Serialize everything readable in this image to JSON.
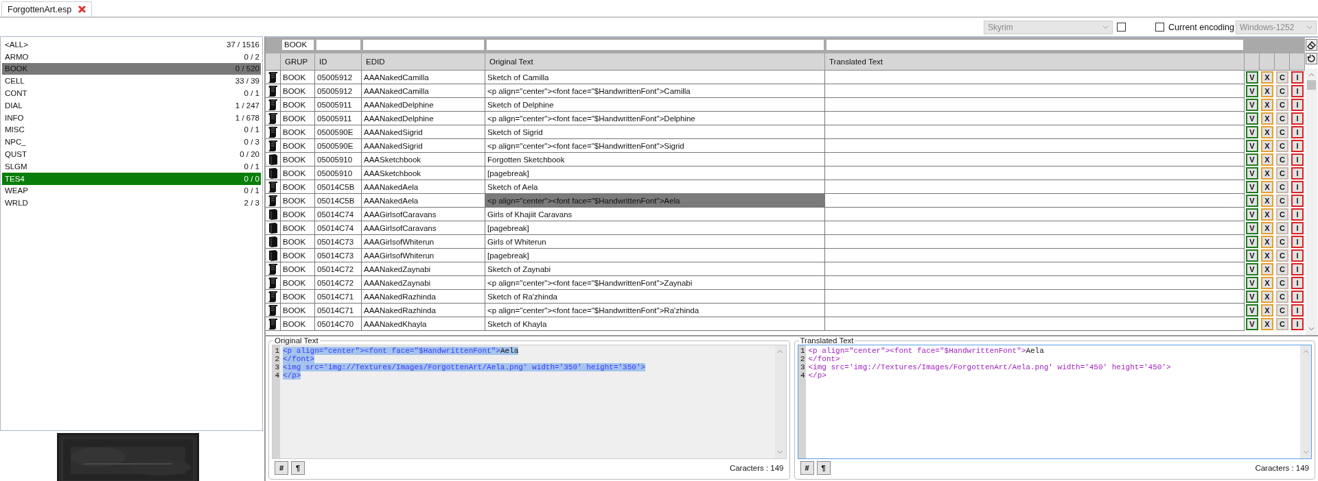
{
  "tabs": [
    {
      "label": "ForgottenArt.esp"
    }
  ],
  "toolbar": {
    "game_select": {
      "value": "Skyrim",
      "disabled": true
    },
    "game_checkbox": {
      "checked": false
    },
    "encoding_checkbox": {
      "label": "Current encoding",
      "checked": false
    },
    "encoding_select": {
      "value": "Windows-1252",
      "disabled": true
    }
  },
  "record_types": [
    {
      "label": "<ALL>",
      "count": "37 / 1516",
      "selected": false,
      "complete": false
    },
    {
      "label": "ARMO",
      "count": "0 / 2",
      "selected": false,
      "complete": false
    },
    {
      "label": "BOOK",
      "count": "0 / 520",
      "selected": true,
      "complete": false
    },
    {
      "label": "CELL",
      "count": "33 / 39",
      "selected": false,
      "complete": false
    },
    {
      "label": "CONT",
      "count": "0 / 1",
      "selected": false,
      "complete": false
    },
    {
      "label": "DIAL",
      "count": "1 / 247",
      "selected": false,
      "complete": false
    },
    {
      "label": "INFO",
      "count": "1 / 678",
      "selected": false,
      "complete": false
    },
    {
      "label": "MISC",
      "count": "0 / 1",
      "selected": false,
      "complete": false
    },
    {
      "label": "NPC_",
      "count": "0 / 3",
      "selected": false,
      "complete": false
    },
    {
      "label": "QUST",
      "count": "0 / 20",
      "selected": false,
      "complete": false
    },
    {
      "label": "SLGM",
      "count": "0 / 1",
      "selected": false,
      "complete": false
    },
    {
      "label": "TES4",
      "count": "0 / 0",
      "selected": false,
      "complete": true
    },
    {
      "label": "WEAP",
      "count": "0 / 1",
      "selected": false,
      "complete": false
    },
    {
      "label": "WRLD",
      "count": "2 / 3",
      "selected": false,
      "complete": false
    }
  ],
  "table": {
    "columns": [
      {
        "label": "GRUP",
        "filter": "BOOK"
      },
      {
        "label": "ID"
      },
      {
        "label": "EDID"
      },
      {
        "label": "Original Text"
      },
      {
        "label": "Translated Text"
      }
    ],
    "rows": [
      {
        "kind": "scroll",
        "grup": "BOOK",
        "id": "05005912",
        "edid": "AAANakedCamilla",
        "original": "Sketch of Camilla",
        "selected": false,
        "actions": [
          {
            "label": "V",
            "color": "#1f7a1f"
          },
          {
            "label": "X",
            "color": "#e8a030"
          },
          {
            "label": "C",
            "color": "#c9b9a6"
          },
          {
            "label": "I",
            "color": "#e02020"
          }
        ]
      },
      {
        "kind": "scroll",
        "grup": "BOOK",
        "id": "05005912",
        "edid": "AAANakedCamilla",
        "original": "<p align=\"center\"><font face=\"$HandwrittenFont\">Camilla",
        "selected": false,
        "actions": [
          {
            "label": "V",
            "color": "#1f7a1f"
          },
          {
            "label": "X",
            "color": "#e8a030"
          },
          {
            "label": "C",
            "color": "#c9b9a6"
          },
          {
            "label": "I",
            "color": "#e02020"
          }
        ]
      },
      {
        "kind": "scroll",
        "grup": "BOOK",
        "id": "05005911",
        "edid": "AAANakedDelphine",
        "original": "Sketch of Delphine",
        "selected": false,
        "actions": [
          {
            "label": "V",
            "color": "#1f7a1f"
          },
          {
            "label": "X",
            "color": "#e8a030"
          },
          {
            "label": "C",
            "color": "#c9b9a6"
          },
          {
            "label": "I",
            "color": "#e02020"
          }
        ]
      },
      {
        "kind": "scroll",
        "grup": "BOOK",
        "id": "05005911",
        "edid": "AAANakedDelphine",
        "original": "<p align=\"center\"><font face=\"$HandwrittenFont\">Delphine",
        "selected": false,
        "actions": [
          {
            "label": "V",
            "color": "#1f7a1f"
          },
          {
            "label": "X",
            "color": "#e8a030"
          },
          {
            "label": "C",
            "color": "#c9b9a6"
          },
          {
            "label": "I",
            "color": "#e02020"
          }
        ]
      },
      {
        "kind": "scroll",
        "grup": "BOOK",
        "id": "0500590E",
        "edid": "AAANakedSigrid",
        "original": "Sketch of Sigrid",
        "selected": false,
        "actions": [
          {
            "label": "V",
            "color": "#1f7a1f"
          },
          {
            "label": "X",
            "color": "#e8a030"
          },
          {
            "label": "C",
            "color": "#c9b9a6"
          },
          {
            "label": "I",
            "color": "#e02020"
          }
        ]
      },
      {
        "kind": "scroll",
        "grup": "BOOK",
        "id": "0500590E",
        "edid": "AAANakedSigrid",
        "original": "<p align=\"center\"><font face=\"$HandwrittenFont\">Sigrid",
        "selected": false,
        "actions": [
          {
            "label": "V",
            "color": "#1f7a1f"
          },
          {
            "label": "X",
            "color": "#e8a030"
          },
          {
            "label": "C",
            "color": "#c9b9a6"
          },
          {
            "label": "I",
            "color": "#e02020"
          }
        ]
      },
      {
        "kind": "book",
        "grup": "BOOK",
        "id": "05005910",
        "edid": "AAASketchbook",
        "original": "Forgotten Sketchbook",
        "selected": false,
        "actions": [
          {
            "label": "V",
            "color": "#1f7a1f"
          },
          {
            "label": "X",
            "color": "#e8a030"
          },
          {
            "label": "C",
            "color": "#c9b9a6"
          },
          {
            "label": "I",
            "color": "#e02020"
          }
        ]
      },
      {
        "kind": "book",
        "grup": "BOOK",
        "id": "05005910",
        "edid": "AAASketchbook",
        "original": "[pagebreak]",
        "selected": false,
        "actions": [
          {
            "label": "V",
            "color": "#1f7a1f"
          },
          {
            "label": "X",
            "color": "#e8a030"
          },
          {
            "label": "C",
            "color": "#c9b9a6"
          },
          {
            "label": "I",
            "color": "#e02020"
          }
        ]
      },
      {
        "kind": "scroll",
        "grup": "BOOK",
        "id": "05014C5B",
        "edid": "AAANakedAela",
        "original": "Sketch of Aela",
        "selected": false,
        "actions": [
          {
            "label": "V",
            "color": "#1f7a1f"
          },
          {
            "label": "X",
            "color": "#e8a030"
          },
          {
            "label": "C",
            "color": "#c9b9a6"
          },
          {
            "label": "I",
            "color": "#e02020"
          }
        ]
      },
      {
        "kind": "scroll",
        "grup": "BOOK",
        "id": "05014C5B",
        "edid": "AAANakedAela",
        "original": "<p align=\"center\"><font face=\"$HandwrittenFont\">Aela",
        "selected": true,
        "actions": [
          {
            "label": "V",
            "color": "#1f7a1f"
          },
          {
            "label": "X",
            "color": "#e8a030"
          },
          {
            "label": "C",
            "color": "#c9b9a6"
          },
          {
            "label": "I",
            "color": "#e02020"
          }
        ]
      },
      {
        "kind": "book",
        "grup": "BOOK",
        "id": "05014C74",
        "edid": "AAAGirlsofCaravans",
        "original": "Girls of Khajiit Caravans",
        "selected": false,
        "actions": [
          {
            "label": "V",
            "color": "#1f7a1f"
          },
          {
            "label": "X",
            "color": "#e8a030"
          },
          {
            "label": "C",
            "color": "#c9b9a6"
          },
          {
            "label": "I",
            "color": "#e02020"
          }
        ]
      },
      {
        "kind": "book",
        "grup": "BOOK",
        "id": "05014C74",
        "edid": "AAAGirlsofCaravans",
        "original": "[pagebreak]",
        "selected": false,
        "actions": [
          {
            "label": "V",
            "color": "#1f7a1f"
          },
          {
            "label": "X",
            "color": "#e8a030"
          },
          {
            "label": "C",
            "color": "#c9b9a6"
          },
          {
            "label": "I",
            "color": "#e02020"
          }
        ]
      },
      {
        "kind": "book",
        "grup": "BOOK",
        "id": "05014C73",
        "edid": "AAAGirlsofWhiterun",
        "original": "Girls of Whiterun",
        "selected": false,
        "actions": [
          {
            "label": "V",
            "color": "#1f7a1f"
          },
          {
            "label": "X",
            "color": "#e8a030"
          },
          {
            "label": "C",
            "color": "#c9b9a6"
          },
          {
            "label": "I",
            "color": "#e02020"
          }
        ]
      },
      {
        "kind": "book",
        "grup": "BOOK",
        "id": "05014C73",
        "edid": "AAAGirlsofWhiterun",
        "original": "[pagebreak]",
        "selected": false,
        "actions": [
          {
            "label": "V",
            "color": "#1f7a1f"
          },
          {
            "label": "X",
            "color": "#e8a030"
          },
          {
            "label": "C",
            "color": "#c9b9a6"
          },
          {
            "label": "I",
            "color": "#e02020"
          }
        ]
      },
      {
        "kind": "scroll",
        "grup": "BOOK",
        "id": "05014C72",
        "edid": "AAANakedZaynabi",
        "original": "Sketch of Zaynabi",
        "selected": false,
        "actions": [
          {
            "label": "V",
            "color": "#1f7a1f"
          },
          {
            "label": "X",
            "color": "#e8a030"
          },
          {
            "label": "C",
            "color": "#c9b9a6"
          },
          {
            "label": "I",
            "color": "#e02020"
          }
        ]
      },
      {
        "kind": "scroll",
        "grup": "BOOK",
        "id": "05014C72",
        "edid": "AAANakedZaynabi",
        "original": "<p align=\"center\"><font face=\"$HandwrittenFont\">Zaynabi",
        "selected": false,
        "actions": [
          {
            "label": "V",
            "color": "#1f7a1f"
          },
          {
            "label": "X",
            "color": "#e8a030"
          },
          {
            "label": "C",
            "color": "#c9b9a6"
          },
          {
            "label": "I",
            "color": "#e02020"
          }
        ]
      },
      {
        "kind": "scroll",
        "grup": "BOOK",
        "id": "05014C71",
        "edid": "AAANakedRazhinda",
        "original": "Sketch of Ra'zhinda",
        "selected": false,
        "actions": [
          {
            "label": "V",
            "color": "#1f7a1f"
          },
          {
            "label": "X",
            "color": "#e8a030"
          },
          {
            "label": "C",
            "color": "#c9b9a6"
          },
          {
            "label": "I",
            "color": "#e02020"
          }
        ]
      },
      {
        "kind": "scroll",
        "grup": "BOOK",
        "id": "05014C71",
        "edid": "AAANakedRazhinda",
        "original": "<p align=\"center\"><font face=\"$HandwrittenFont\">Ra'zhinda",
        "selected": false,
        "actions": [
          {
            "label": "V",
            "color": "#1f7a1f"
          },
          {
            "label": "X",
            "color": "#e8a030"
          },
          {
            "label": "C",
            "color": "#c9b9a6"
          },
          {
            "label": "I",
            "color": "#e02020"
          }
        ]
      },
      {
        "kind": "scroll",
        "grup": "BOOK",
        "id": "05014C70",
        "edid": "AAANakedKhayla",
        "original": "Sketch of Khayla",
        "selected": false,
        "actions": [
          {
            "label": "V",
            "color": "#1f7a1f"
          },
          {
            "label": "X",
            "color": "#e8a030"
          },
          {
            "label": "C",
            "color": "#c9b9a6"
          },
          {
            "label": "I",
            "color": "#e02020"
          }
        ]
      }
    ]
  },
  "original_editor": {
    "title": "Original Text",
    "selected": true,
    "focused": false,
    "lines": [
      {
        "number": "1",
        "text": "<p align=\"center\"><font face=\"$HandwrittenFont\">Aela"
      },
      {
        "number": "2",
        "text": "</font>"
      },
      {
        "number": "3",
        "text": "<img src='img://Textures/Images/ForgottenArt/Aela.png' width='350' height='350'>"
      },
      {
        "number": "4",
        "text": "</p>"
      }
    ],
    "buttons": [
      "#",
      "¶"
    ],
    "char_count": "Caracters : 149"
  },
  "translated_editor": {
    "title": "Translated Text",
    "selected": false,
    "focused": true,
    "lines": [
      {
        "number": "1",
        "text": "<p align=\"center\"><font face=\"$HandwrittenFont\">Aela"
      },
      {
        "number": "2",
        "text": "</font>"
      },
      {
        "number": "3",
        "text": "<img src='img://Textures/Images/ForgottenArt/Aela.png' width='450' height='450'>"
      },
      {
        "number": "4",
        "text": "</p>"
      }
    ],
    "buttons": [
      "#",
      "¶"
    ],
    "char_count": "Caracters : 149"
  }
}
